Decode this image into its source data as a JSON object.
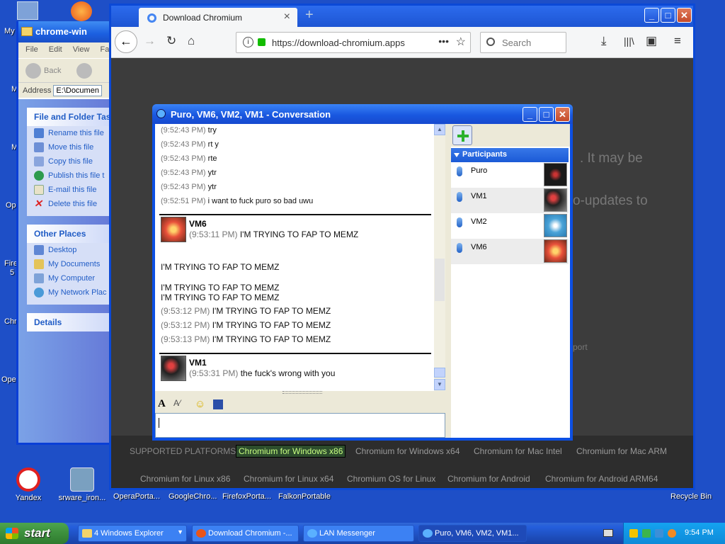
{
  "desktop": {
    "icons": [
      {
        "label": "Yandex",
        "color": "#e02020"
      },
      {
        "label": "srware_iron...",
        "color": "#7aa0c0"
      }
    ],
    "bottom_labels": [
      "OperaPorta...",
      "GoogleChro...",
      "FirefoxPorta...",
      "FalkonPortable"
    ],
    "recycle_bin": "Recycle Bin",
    "left_edge_labels": [
      "My",
      "M",
      "M",
      "Op",
      "Fire",
      "5",
      "Chr",
      "Ope"
    ]
  },
  "explorer": {
    "title": "chrome-win",
    "menu": "File Edit View Fa",
    "back_label": "Back",
    "address_label": "Address",
    "address_value": "E:\\Documen",
    "tasks_header": "File and Folder Tas",
    "tasks": [
      "Rename this file",
      "Move this file",
      "Copy this file",
      "Publish this file t",
      "E-mail this file",
      "Delete this file"
    ],
    "places_header": "Other Places",
    "places": [
      "Desktop",
      "My Documents",
      "My Computer",
      "My Network Plac"
    ],
    "details_header": "Details"
  },
  "firefox": {
    "tab_title": "Download Chromium",
    "tab_close": "×",
    "new_tab": "+",
    "url": "https://download-chromium.apps",
    "search_placeholder": "Search",
    "page_ghost_text_1": ". It may be",
    "page_ghost_text_2": "o-updates to",
    "page_ghost_text_3": "port",
    "platforms_label": "SUPPORTED PLATFORMS:",
    "platforms_row1": [
      "Chromium for Windows x86",
      "Chromium for Windows x64",
      "Chromium for Mac Intel",
      "Chromium for Mac ARM"
    ],
    "platforms_row2": [
      "Chromium for Linux x86",
      "Chromium for Linux x64",
      "Chromium OS for Linux",
      "Chromium for Android",
      "Chromium for Android ARM64"
    ]
  },
  "conversation": {
    "title": "Puro, VM6, VM2, VM1 - Conversation",
    "messages_top": [
      {
        "time": "(9:52:43 PM)",
        "text": "try"
      },
      {
        "time": "(9:52:43 PM)",
        "text": "rt y"
      },
      {
        "time": "(9:52:43 PM)",
        "text": "rte"
      },
      {
        "time": "(9:52:43 PM)",
        "text": "ytr"
      },
      {
        "time": "(9:52:43 PM)",
        "text": "ytr"
      },
      {
        "time": "(9:52:51 PM)",
        "text": "i want to fuck puro so bad uwu"
      }
    ],
    "vm6_block": {
      "name": "VM6",
      "time": "(9:53:11 PM)",
      "text": "I'M TRYING TO FAP TO MEMZ",
      "loose_lines": [
        "I'M TRYING TO FAP TO MEMZ",
        "I'M TRYING TO FAP TO MEMZ",
        "I'M TRYING TO FAP TO MEMZ"
      ],
      "timed_lines": [
        {
          "time": "(9:53:12 PM)",
          "text": "I'M TRYING TO FAP TO MEMZ"
        },
        {
          "time": "(9:53:12 PM)",
          "text": "I'M TRYING TO FAP TO MEMZ"
        },
        {
          "time": "(9:53:13 PM)",
          "text": "I'M TRYING TO FAP TO MEMZ"
        }
      ]
    },
    "vm1_block": {
      "name": "VM1",
      "time": "(9:53:31 PM)",
      "text": "the fuck's wrong with you"
    },
    "participants_header": "Participants",
    "participants": [
      {
        "name": "Puro",
        "color": "#1a1a1a"
      },
      {
        "name": "VM1",
        "color": "#2a2a2a"
      },
      {
        "name": "VM2",
        "color": "#4aa3d8"
      },
      {
        "name": "VM6",
        "color": "#e8503a"
      }
    ]
  },
  "taskbar": {
    "start": "start",
    "buttons": [
      "4 Windows Explorer",
      "Download Chromium -...",
      "LAN Messenger",
      "Puro, VM6, VM2, VM1..."
    ],
    "clock": "9:54 PM"
  }
}
